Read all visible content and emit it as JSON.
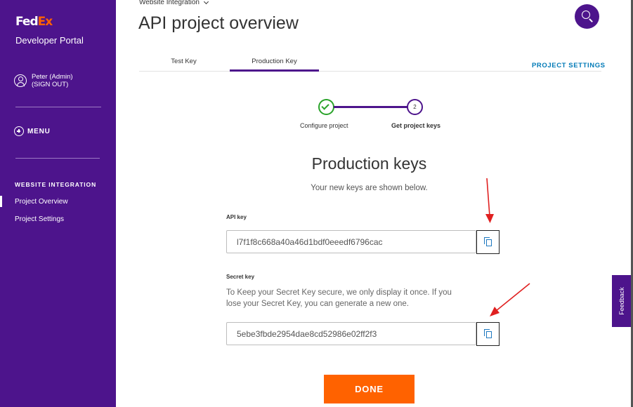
{
  "sidebar": {
    "logo_fed": "Fed",
    "logo_ex": "Ex",
    "portal_name": "Developer Portal",
    "user_name": "Peter (Admin)",
    "sign_out": "(SIGN OUT)",
    "menu_label": "MENU",
    "section_title": "WEBSITE INTEGRATION",
    "nav_items": [
      {
        "label": "Project Overview",
        "active": true
      },
      {
        "label": "Project Settings",
        "active": false
      }
    ]
  },
  "header": {
    "breadcrumb": "Website Integration",
    "page_title": "API project overview"
  },
  "tabs": [
    {
      "label": "Test Key",
      "active": false
    },
    {
      "label": "Production Key",
      "active": true
    }
  ],
  "project_settings_link": "PROJECT SETTINGS",
  "stepper": {
    "steps": [
      {
        "label": "Configure project",
        "status": "complete"
      },
      {
        "label": "Get project keys",
        "number": "2",
        "status": "current"
      }
    ]
  },
  "keys": {
    "title": "Production keys",
    "subtitle": "Your new keys are shown below.",
    "api_key_label": "API key",
    "api_key_value": "l7f1f8c668a40a46d1bdf0eeedf6796cac",
    "secret_key_label": "Secret key",
    "secret_note": "To Keep your Secret Key secure, we only display it once. If you lose your Secret Key, you can generate a new one.",
    "secret_key_value": "5ebe3fbde2954dae8cd52986e02ff2f3"
  },
  "done_label": "DONE",
  "feedback_label": "Feedback",
  "colors": {
    "brand_purple": "#4d148c",
    "brand_orange": "#ff6200",
    "link_blue": "#007ab7",
    "success_green": "#29a329",
    "annotation_red": "#e02020"
  }
}
